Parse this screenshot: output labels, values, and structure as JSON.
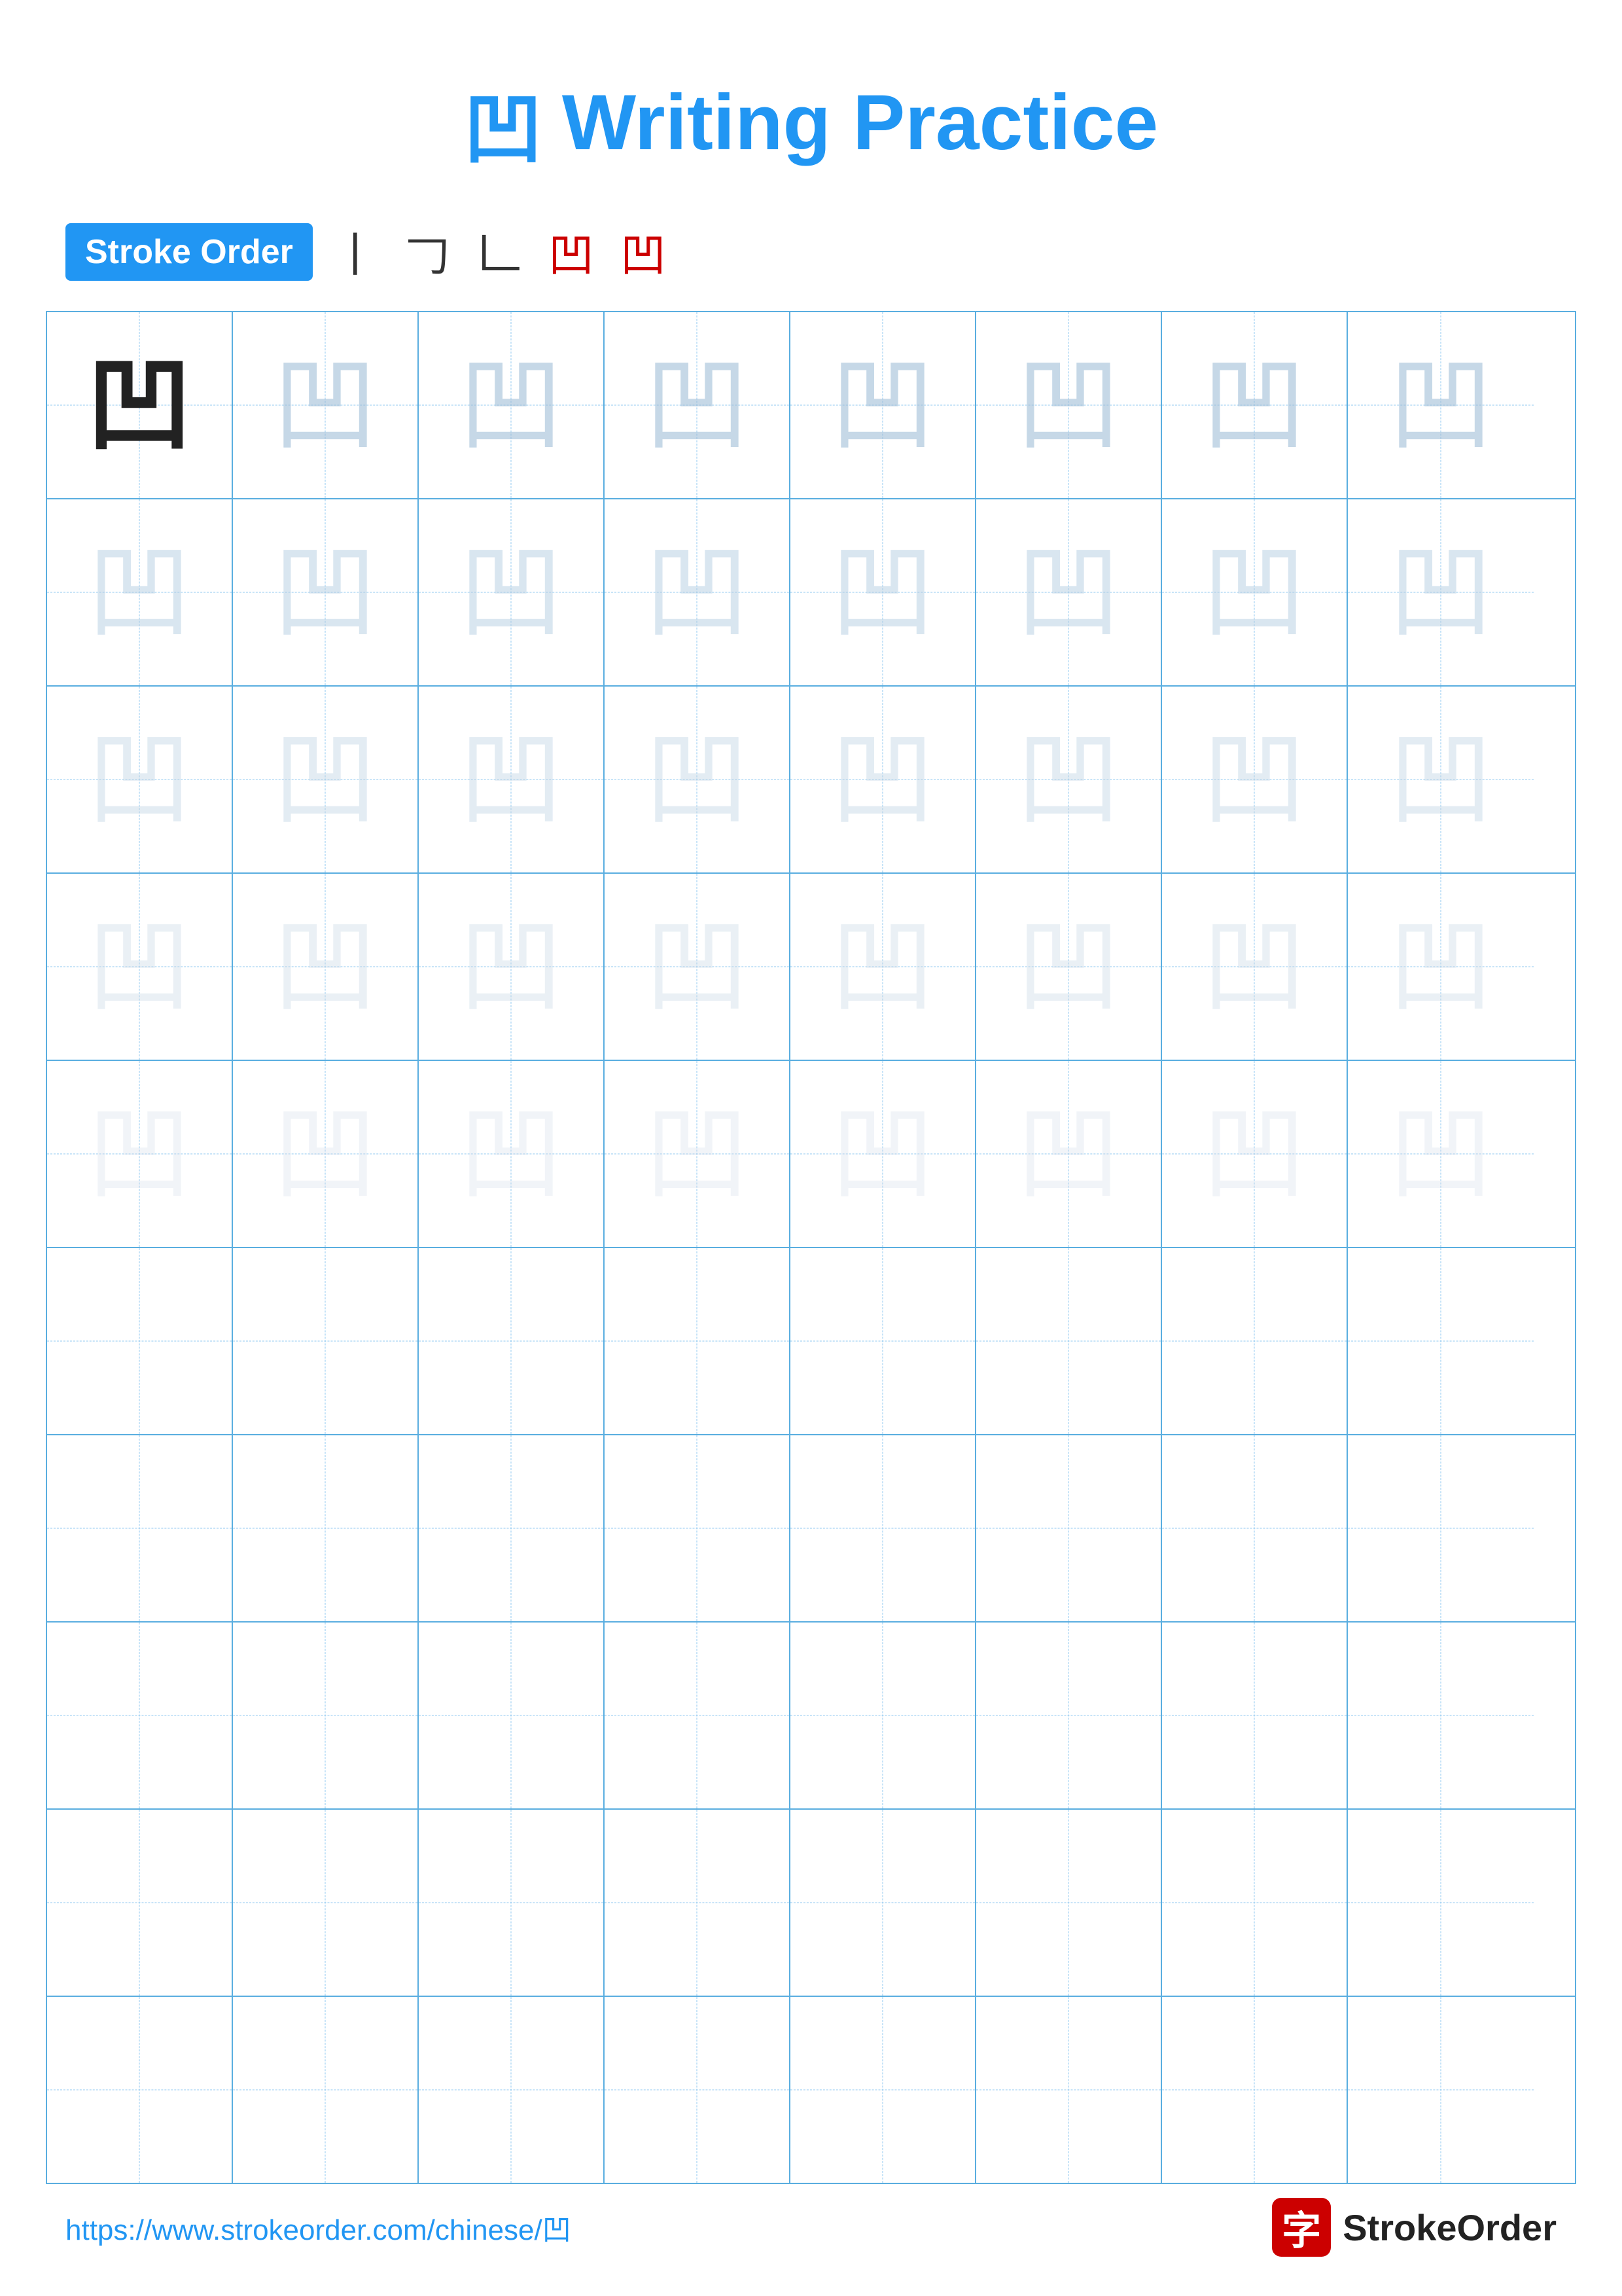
{
  "page": {
    "title": "Writing Practice",
    "title_char": "凹",
    "stroke_order_label": "Stroke Order",
    "stroke_steps": [
      "丨",
      "𠃌",
      "𠃊",
      "凹",
      "凹"
    ],
    "character": "凹",
    "grid_rows": 10,
    "grid_cols": 8,
    "ghost_rows": 5,
    "footer_url": "https://www.strokeorder.com/chinese/凹",
    "footer_brand": "StrokeOrder"
  }
}
